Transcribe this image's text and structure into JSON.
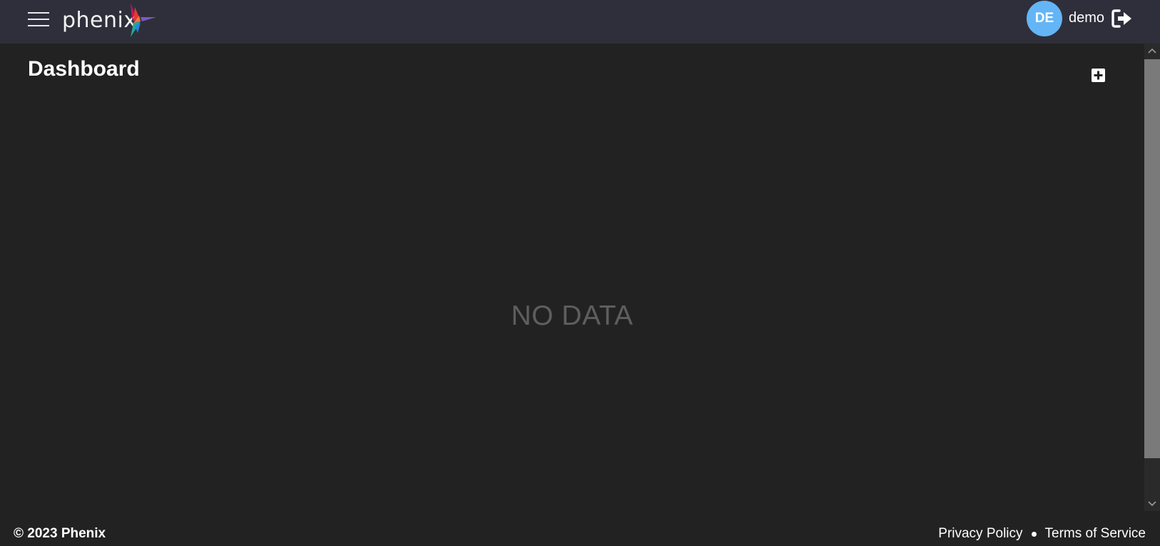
{
  "header": {
    "logo_text": "phenix",
    "user_initials": "DE",
    "username": "demo",
    "avatar_color": "#64b5f6",
    "icons": {
      "menu": "hamburger-menu-icon",
      "logout": "logout-icon"
    }
  },
  "main": {
    "title": "Dashboard",
    "empty_message": "NO DATA",
    "add_icon": "plus-square-icon"
  },
  "footer": {
    "copyright": "© 2023 Phenix",
    "links": [
      {
        "label": "Privacy Policy"
      },
      {
        "label": "Terms of Service"
      }
    ]
  },
  "colors": {
    "topbar": "#2e2f3a",
    "background": "#222222",
    "muted_text": "#5e5e5e"
  }
}
